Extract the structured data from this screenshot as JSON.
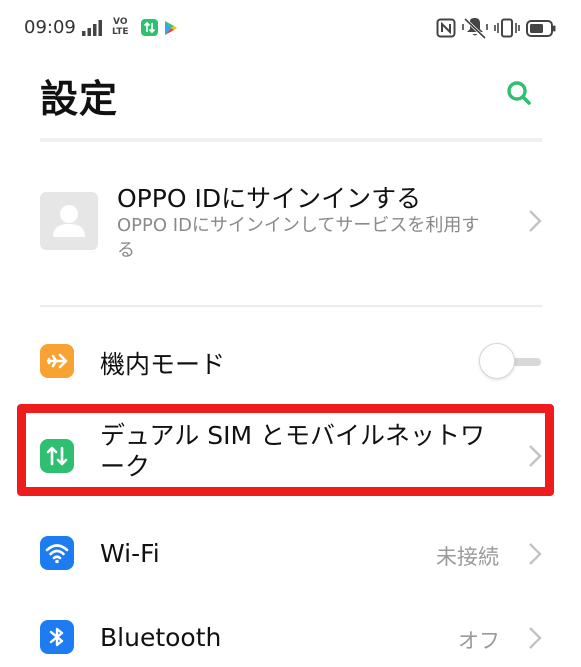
{
  "status_bar": {
    "time": "09:09",
    "volte_line1": "VO",
    "volte_line2": "LTE",
    "icons": [
      "signal-icon",
      "volte-icon",
      "data-transfer-app-icon",
      "play-store-icon",
      "nfc-icon",
      "mute-vibrate-icon",
      "vibrate-icon",
      "battery-icon"
    ]
  },
  "header": {
    "title": "設定",
    "search_icon": "search-icon"
  },
  "account": {
    "title": "OPPO IDにサインインする",
    "subtitle": "OPPO IDにサインインしてサービスを利用する",
    "icon": "person-icon"
  },
  "settings": {
    "airplane": {
      "label": "機内モード",
      "icon": "airplane-icon",
      "toggle_on": false
    },
    "dual_sim": {
      "label_line1": "デュアル SIM とモバイルネットワ",
      "label_line2": "ーク",
      "icon": "mobile-data-icon"
    },
    "wifi": {
      "label": "Wi-Fi",
      "value": "未接続",
      "icon": "wifi-icon"
    },
    "bluetooth": {
      "label": "Bluetooth",
      "value": "オフ",
      "icon": "bluetooth-icon"
    }
  },
  "colors": {
    "accent_green": "#2fbf71",
    "airplane_orange": "#f7a233",
    "blue": "#1e7cf2",
    "highlight_red": "#ee1c1c"
  }
}
